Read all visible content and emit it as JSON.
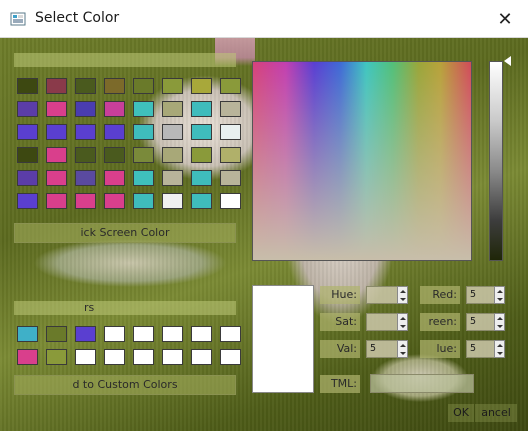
{
  "window": {
    "title": "Select Color",
    "close_icon": "close-icon",
    "app_icon": "color-dialog-icon"
  },
  "basic_colors": {
    "label": "",
    "swatches": [
      [
        "#3d4811",
        "#8a3a4a",
        "#4a5a1e",
        "#7c6a2a",
        "#6a7a2a",
        "#8a9a3a",
        "#a8a83a",
        "#8a9a3a"
      ],
      [
        "#5b3da8",
        "#d93f8c",
        "#4a3db0",
        "#c83f9a",
        "#3fc0bc",
        "#a8a878",
        "#3fbcbc",
        "#b8b49a"
      ],
      [
        "#5a3fd0",
        "#5a3fd0",
        "#5a3fd0",
        "#5a3fd0",
        "#3fbcbc",
        "#b8b8b8",
        "#3fbcbc",
        "#e8f0f0"
      ],
      [
        "#3d4811",
        "#d93f8c",
        "#4a5a1e",
        "#4a5a1e",
        "#7a8a3a",
        "#a8a878",
        "#8a9a3a",
        "#b0b06a"
      ],
      [
        "#5b3da8",
        "#d93f8c",
        "#5a4aa0",
        "#d93f8c",
        "#3fc0bc",
        "#b8b49a",
        "#3fbcbc",
        "#b8b49a"
      ],
      [
        "#5a3fd0",
        "#d93f8c",
        "#d93f8c",
        "#d93f8c",
        "#3fbcbc",
        "#f0f0f0",
        "#3fbcbc",
        "#ffffff"
      ]
    ]
  },
  "pick_screen_color_button": "ick Screen Color",
  "custom_colors": {
    "label": "rs",
    "swatches": [
      [
        "#3fb0c8",
        "#6a7a2a",
        "#5a3fd0",
        "#ffffff",
        "#ffffff",
        "#ffffff",
        "#ffffff",
        "#ffffff"
      ],
      [
        "#d93f8c",
        "#8a9a3a",
        "#ffffff",
        "#ffffff",
        "#ffffff",
        "#ffffff",
        "#ffffff",
        "#ffffff"
      ]
    ]
  },
  "add_custom_button": "d to Custom Colors",
  "fields": {
    "hue": {
      "label": "Hue:",
      "value": ""
    },
    "sat": {
      "label": "Sat:",
      "value": ""
    },
    "val": {
      "label": "Val:",
      "value": "5"
    },
    "red": {
      "label": "Red:",
      "value": "5"
    },
    "green": {
      "label": "reen:",
      "value": "5"
    },
    "blue": {
      "label": "lue:",
      "value": "5"
    },
    "html": {
      "label": "TML:",
      "value": ""
    }
  },
  "buttons": {
    "ok": "OK",
    "cancel": "ancel"
  },
  "colors": {
    "current_color": "#ffffff"
  }
}
